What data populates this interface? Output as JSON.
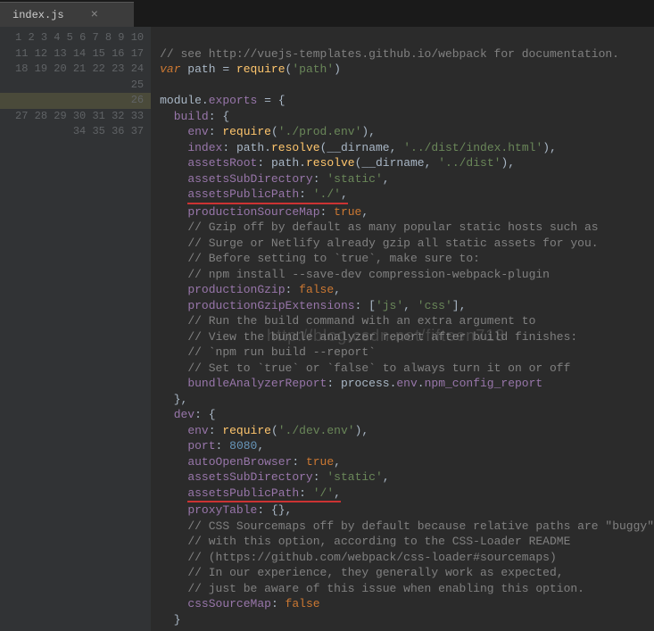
{
  "tab": {
    "title": "index.js",
    "close": "×"
  },
  "watermark": "http://blog.csdn.net/fifteen718",
  "code": {
    "l1": "// see http://vuejs-templates.github.io/webpack for documentation.",
    "l2_var": "var",
    "l2_path": " path ",
    "l2_eq": "= ",
    "l2_require": "require",
    "l2_arg": "'path'",
    "l4_module": "module",
    "l4_exports": "exports",
    "l5_build": "build",
    "l6_env": "env",
    "l6_require": "require",
    "l6_arg": "'./prod.env'",
    "l7_index": "index",
    "l7_path": "path",
    "l7_resolve": "resolve",
    "l7_dirname": "__dirname",
    "l7_arg": "'../dist/index.html'",
    "l8_assetsRoot": "assetsRoot",
    "l8_arg": "'../dist'",
    "l9_assetsSubDirectory": "assetsSubDirectory",
    "l9_val": "'static'",
    "l10_assetsPublicPath": "assetsPublicPath",
    "l10_val": "'./'",
    "l11_productionSourceMap": "productionSourceMap",
    "l11_true": "true",
    "l12": "// Gzip off by default as many popular static hosts such as",
    "l13": "// Surge or Netlify already gzip all static assets for you.",
    "l14": "// Before setting to `true`, make sure to:",
    "l15": "// npm install --save-dev compression-webpack-plugin",
    "l16_productionGzip": "productionGzip",
    "l16_false": "false",
    "l17_productionGzipExtensions": "productionGzipExtensions",
    "l17_js": "'js'",
    "l17_css": "'css'",
    "l18": "// Run the build command with an extra argument to",
    "l19": "// View the bundle analyzer report after build finishes:",
    "l20": "// `npm run build --report`",
    "l21": "// Set to `true` or `false` to always turn it on or off",
    "l22_bundleAnalyzerReport": "bundleAnalyzerReport",
    "l22_process": "process",
    "l22_env": "env",
    "l22_npm": "npm_config_report",
    "l24_dev": "dev",
    "l25_arg": "'./dev.env'",
    "l26_port": "port",
    "l26_val": "8080",
    "l27_autoOpenBrowser": "autoOpenBrowser",
    "l29_val": "'/'",
    "l30_proxyTable": "proxyTable",
    "l31": "// CSS Sourcemaps off by default because relative paths are \"buggy\"",
    "l32": "// with this option, according to the CSS-Loader README",
    "l33": "// (https://github.com/webpack/css-loader#sourcemaps)",
    "l34": "// In our experience, they generally work as expected,",
    "l35": "// just be aware of this issue when enabling this option.",
    "l36_cssSourceMap": "cssSourceMap"
  }
}
